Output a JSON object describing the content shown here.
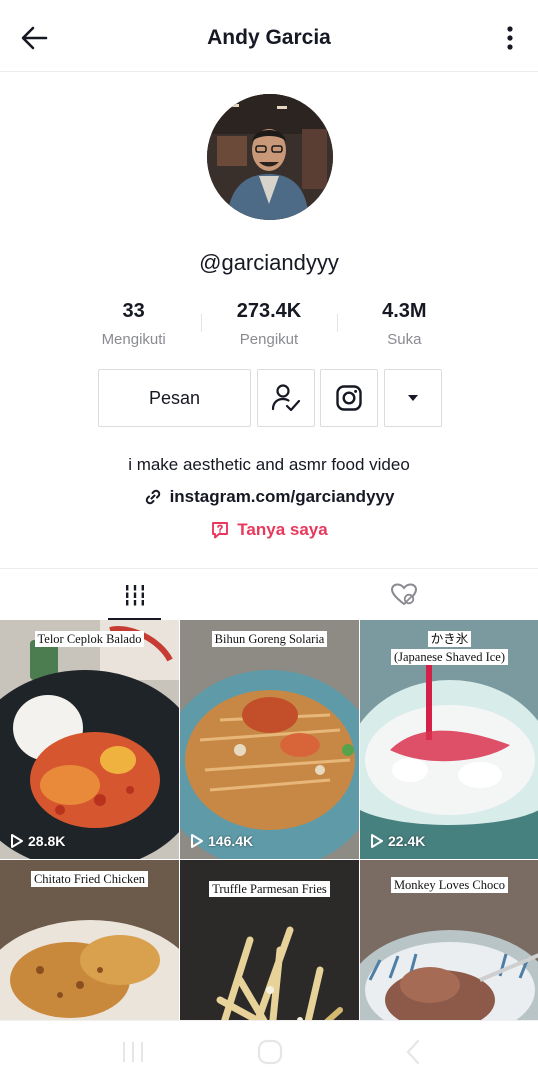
{
  "header": {
    "title": "Andy Garcia"
  },
  "profile": {
    "username": "@garciandyyy",
    "stats": [
      {
        "value": "33",
        "label": "Mengikuti"
      },
      {
        "value": "273.4K",
        "label": "Pengikut"
      },
      {
        "value": "4.3M",
        "label": "Suka"
      }
    ],
    "message_button": "Pesan",
    "bio": "i make aesthetic and asmr food video",
    "link": "instagram.com/garciandyyy",
    "ask_label": "Tanya saya"
  },
  "tabs": [
    {
      "icon": "videos-grid-icon",
      "active": true
    },
    {
      "icon": "liked-videos-hidden-icon",
      "active": false
    }
  ],
  "videos": [
    {
      "caption": [
        "Telor Ceplok Balado"
      ],
      "views": "28.8K"
    },
    {
      "caption": [
        "Bihun Goreng Solaria"
      ],
      "views": "146.4K"
    },
    {
      "caption": [
        "かき氷",
        "(Japanese Shaved Ice)"
      ],
      "views": "22.4K"
    },
    {
      "caption": [
        "Chitato Fried Chicken"
      ],
      "views": ""
    },
    {
      "caption": [
        "Truffle Parmesan Fries"
      ],
      "views": ""
    },
    {
      "caption": [
        "Monkey Loves Choco"
      ],
      "views": ""
    }
  ],
  "colors": {
    "accent_pink": "#e8385c",
    "text_dark": "#161823",
    "text_muted": "#8a8b91"
  }
}
